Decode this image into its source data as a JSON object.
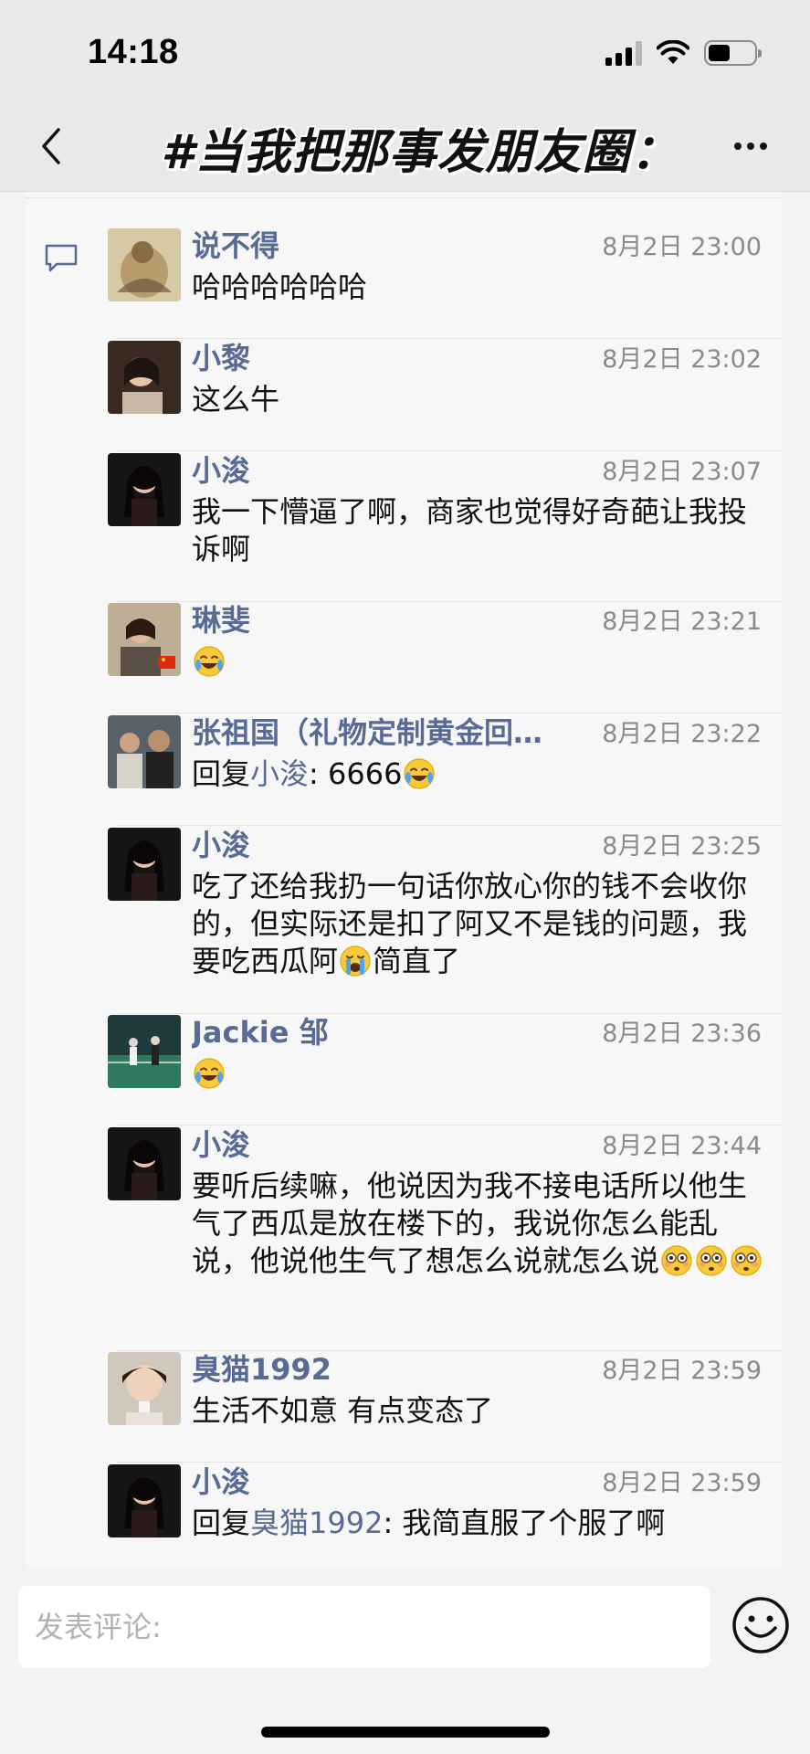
{
  "status_bar": {
    "time": "14:18",
    "icons": [
      "signal-icon",
      "wifi-icon",
      "battery-icon"
    ],
    "battery_level": 0.48
  },
  "nav": {
    "back_icon": "chevron-left-icon",
    "title": "#当我把那事发朋友圈：",
    "more_icon": "more-dots-icon"
  },
  "comments": [
    {
      "name": "说不得",
      "time": "8月2日 23:00",
      "text": "哈哈哈哈哈哈",
      "avatar": "painting-avatar"
    },
    {
      "name": "小黎",
      "time": "8月2日 23:02",
      "text": "这么牛",
      "avatar": "woman-avatar"
    },
    {
      "name": "小浚",
      "time": "8月2日 23:07",
      "text": "我一下懵逼了啊，商家也觉得好奇葩让我投诉啊",
      "avatar": "girl-avatar"
    },
    {
      "name": "琳斐",
      "time": "8月2日 23:21",
      "text": "",
      "emojis": [
        "laugh-cry-emoji"
      ],
      "avatar": "flag-avatar"
    },
    {
      "name": "张祖国（礼物定制黄金回…",
      "time": "8月2日 23:22",
      "reply_prefix": "回复",
      "reply_to": "小浚",
      "text": ": 6666",
      "emojis": [
        "laugh-cry-emoji"
      ],
      "avatar": "men-avatar"
    },
    {
      "name": "小浚",
      "time": "8月2日 23:25",
      "text": "吃了还给我扔一句话你放心你的钱不会收你的，但实际还是扣了阿又不是钱的问题，我要吃西瓜阿",
      "emojis": [
        "crying-emoji"
      ],
      "text_after": "简直了",
      "avatar": "girl-avatar"
    },
    {
      "name": "Jackie 邹",
      "time": "8月2日 23:36",
      "text": "",
      "emojis": [
        "laugh-cry-emoji"
      ],
      "avatar": "court-avatar"
    },
    {
      "name": "小浚",
      "time": "8月2日 23:44",
      "text": "要听后续嘛，他说因为我不接电话所以他生气了西瓜是放在楼下的，我说你怎么能乱说，他说他生气了想怎么说就怎么说",
      "emojis": [
        "flushed-emoji",
        "flushed-emoji",
        "flushed-emoji"
      ],
      "avatar": "girl-avatar"
    },
    {
      "name": "臭猫1992",
      "time": "8月2日 23:59",
      "text": "生活不如意 有点变态了",
      "avatar": "child-avatar"
    },
    {
      "name": "小浚",
      "time": "8月2日 23:59",
      "reply_prefix": "回复",
      "reply_to": "臭猫1992",
      "text": ": 我简直服了个服了啊",
      "avatar": "girl-avatar"
    }
  ],
  "input": {
    "placeholder": "发表评论:",
    "emoji_button_icon": "smiley-icon"
  }
}
